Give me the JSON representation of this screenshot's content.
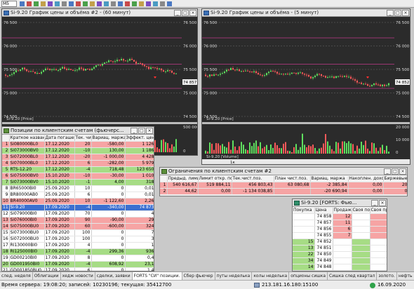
{
  "toolbar": {
    "timeframe": "M5"
  },
  "chart1": {
    "title": "Si-9.20 График цены и объёма #2 - (60 минут)",
    "price_levels": [
      "76 500",
      "76 000",
      "75 500",
      "75 000",
      "74 500"
    ],
    "last_price": "74 857",
    "price_label": "Si-9.20 [Price]",
    "volume_levels": [
      "500 000",
      "0"
    ]
  },
  "chart2": {
    "title": "Si-9.20 График цены и объёма - (5 минут)",
    "price_levels": [
      "76 500",
      "76 000",
      "75 500",
      "75 000",
      "74 500"
    ],
    "last_price": "74 852",
    "price_label": "Si-9.20 [Price]",
    "volume_label": "Si-9.20 [Volume]",
    "volume_levels": [
      "20 000",
      "10 000",
      "0"
    ],
    "date_label": "1к"
  },
  "positions": {
    "title": "Позиции по клиентским счетам (фьючерс...",
    "columns": [
      "",
      "Краткое название",
      "Дата погаше",
      "Тек. чист",
      "Вариац. маржа",
      "Эффект. цен"
    ],
    "rows": [
      {
        "n": "1",
        "name": "Si080000BL0",
        "date": "17.12.2020",
        "qty": "20",
        "var": "-580,00",
        "eff": "1 126",
        "color": "red"
      },
      {
        "n": "2",
        "name": "Si073000BV0",
        "date": "17.12.2020",
        "qty": "-10",
        "var": "130,00",
        "eff": "1 186",
        "color": "green"
      },
      {
        "n": "3",
        "name": "Si072000BL0",
        "date": "17.12.2020",
        "qty": "-20",
        "var": "-1 000,00",
        "eff": "4 428",
        "color": "red"
      },
      {
        "n": "4",
        "name": "Si070000BL0",
        "date": "17.12.2020",
        "qty": "6",
        "var": "-282,00",
        "eff": "5 979",
        "color": "red"
      },
      {
        "n": "5",
        "name": "RTS-12.20",
        "date": "17.12.2020",
        "qty": "-4",
        "var": "718,48",
        "eff": "123 650",
        "color": "green"
      },
      {
        "n": "6",
        "name": "Si075000BV0",
        "date": "15.10.2020",
        "qty": "-10",
        "var": "-30,00",
        "eff": "1 010",
        "color": "red"
      },
      {
        "n": "7",
        "name": "Si073000BV0",
        "date": "15.10.2020",
        "qty": "-1",
        "var": "4,00",
        "eff": "318",
        "color": "green"
      },
      {
        "n": "8",
        "name": "BR65000BI0",
        "date": "25.09.2020",
        "qty": "10",
        "var": "0",
        "eff": "0,01",
        "color": "white"
      },
      {
        "n": "9",
        "name": "BR80000AB0",
        "date": "25.09.2020",
        "qty": "6",
        "var": "0",
        "eff": "0,01",
        "color": "white"
      },
      {
        "n": "10",
        "name": "BR40000AV0",
        "date": "25.09.2020",
        "qty": "10",
        "var": "-1 122,60",
        "eff": "2,26",
        "color": "red"
      },
      {
        "n": "11",
        "name": "Si-9.20",
        "date": "17.09.2020",
        "qty": "-4",
        "var": "-340,00",
        "eff": "74 873",
        "color": "red"
      },
      {
        "n": "12",
        "name": "Si079000BI0",
        "date": "17.09.2020",
        "qty": "70",
        "var": "0",
        "eff": "4",
        "color": "white"
      },
      {
        "n": "13",
        "name": "Si076000BI0",
        "date": "17.09.2020",
        "qty": "90",
        "var": "-90,00",
        "eff": "29",
        "color": "red"
      },
      {
        "n": "14",
        "name": "Si075000BU0",
        "date": "17.09.2020",
        "qty": "60",
        "var": "-600,00",
        "eff": "324",
        "color": "red"
      },
      {
        "n": "15",
        "name": "Si073000BU0",
        "date": "17.09.2020",
        "qty": "100",
        "var": "0",
        "eff": "7",
        "color": "white"
      },
      {
        "n": "16",
        "name": "Si072000BU0",
        "date": "17.09.2020",
        "qty": "100",
        "var": "0",
        "eff": "3",
        "color": "white"
      },
      {
        "n": "17",
        "name": "RI130000BI0",
        "date": "17.09.2020",
        "qty": "4",
        "var": "0",
        "eff": "1",
        "color": "white"
      },
      {
        "n": "18",
        "name": "RI125000BI0",
        "date": "17.09.2020",
        "qty": "-4",
        "var": "299,36",
        "eff": "936",
        "color": "green"
      },
      {
        "n": "19",
        "name": "GD00210BI0",
        "date": "17.09.2020",
        "qty": "8",
        "var": "0",
        "eff": "0,4",
        "color": "white"
      },
      {
        "n": "20",
        "name": "GD001950BI0",
        "date": "17.09.2020",
        "qty": "-4",
        "var": "608,92",
        "eff": "23,1",
        "color": "green"
      },
      {
        "n": "21",
        "name": "GD001850BU0",
        "date": "17.09.2020",
        "qty": "6",
        "var": "0",
        "eff": "1,4",
        "color": "white"
      }
    ]
  },
  "limits": {
    "title": "Ограничения по клиентским счетам #2",
    "columns": [
      "",
      "Предыд. лимит",
      "Лимит откр. поз.",
      "Тек.чист.поз.",
      "План чист.поз.",
      "Вариац. маржа",
      "Накоплен. доход",
      "Биржевые"
    ],
    "rows": [
      {
        "n": "1",
        "cells": [
          "540 616,67",
          "519 884,11",
          "456 803,43",
          "63 080,68",
          "-2 385,84",
          "0,00",
          "20"
        ],
        "color": "red"
      },
      {
        "n": "2",
        "cells": [
          "44,62",
          "0,00",
          "-1 134 038,85",
          "",
          "-20 690,94",
          "0,00",
          "0"
        ],
        "color": "red"
      }
    ]
  },
  "dom": {
    "title": "Si-9.20 [FORTS: Фью...",
    "columns": [
      "Покупка",
      "Цена",
      "Продажа",
      "Своя по",
      "Своя пр"
    ],
    "asks": [
      {
        "price": "74 858",
        "qty": "12"
      },
      {
        "price": "74 857",
        "qty": "11"
      },
      {
        "price": "74 856",
        "qty": "6"
      },
      {
        "price": "74 855",
        "qty": "7"
      }
    ],
    "bids": [
      {
        "qty": "15",
        "price": "74 852"
      },
      {
        "qty": "13",
        "price": "74 851"
      },
      {
        "qty": "22",
        "price": "74 850"
      },
      {
        "qty": "34",
        "price": "74 849"
      },
      {
        "qty": "14",
        "price": "74 848"
      }
    ]
  },
  "tabs": [
    "след. неделя",
    "Облигации",
    "хедж новости",
    "сделки, заявки",
    "FORTS \"СИ\" позиции.",
    "Сбер фьючер",
    "путы неделька",
    "колы неделька",
    "опционы сишка",
    "Сишка след квартал",
    "золото.",
    "нефть",
    "опционы ртс"
  ],
  "active_tab": 4,
  "status": {
    "server_time": "Время сервера: 19:08:20; записей: 10230196; текущая: 35412700",
    "ip": "213.181.16.180:15100",
    "date": "16.09.2020"
  },
  "colors": {
    "ask": "#f6a4a4",
    "bid": "#a6dc85",
    "chart_bg": "#2b2b2b",
    "grid_pink": "#c03b8a",
    "grid_gray": "#6b6b6b"
  }
}
